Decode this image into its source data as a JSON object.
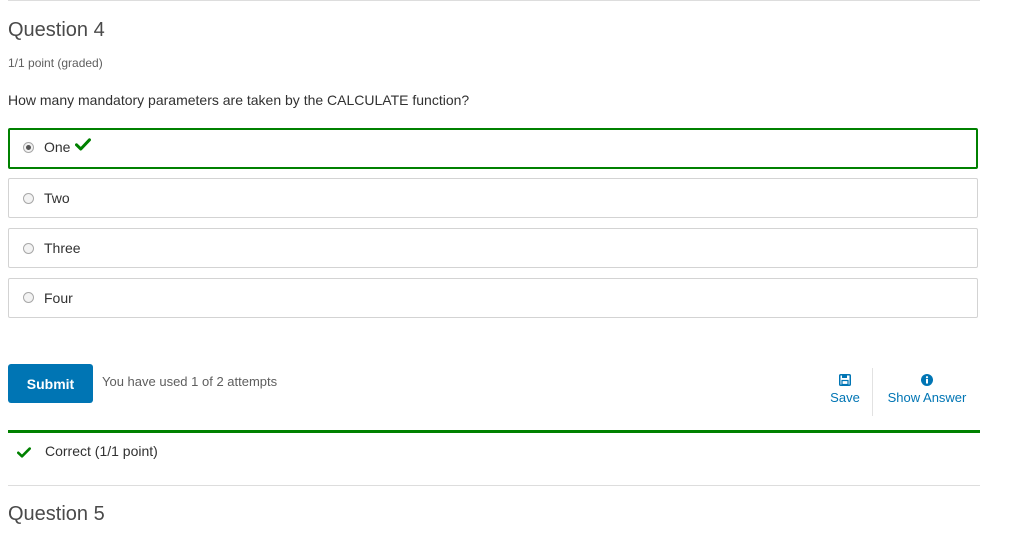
{
  "question": {
    "title": "Question 4",
    "points": "1/1 point (graded)",
    "prompt": "How many mandatory parameters are taken by the CALCULATE function?",
    "options": [
      {
        "label": "One",
        "selected": true,
        "correct": true
      },
      {
        "label": "Two",
        "selected": false,
        "correct": false
      },
      {
        "label": "Three",
        "selected": false,
        "correct": false
      },
      {
        "label": "Four",
        "selected": false,
        "correct": false
      }
    ]
  },
  "actions": {
    "submit_label": "Submit",
    "attempts_text": "You have used 1 of 2 attempts",
    "save_label": "Save",
    "save_icon": "floppy-disk-icon",
    "show_answer_label": "Show Answer",
    "show_answer_icon": "info-circle-icon"
  },
  "feedback": {
    "text": "Correct (1/1 point)",
    "status": "correct",
    "icon": "checkmark-icon"
  },
  "next_question": {
    "title": "Question 5"
  },
  "colors": {
    "accent": "#0075b4",
    "correct": "#008100",
    "text": "#313131",
    "muted": "#5e5e5e",
    "border": "#d3d3d3"
  }
}
